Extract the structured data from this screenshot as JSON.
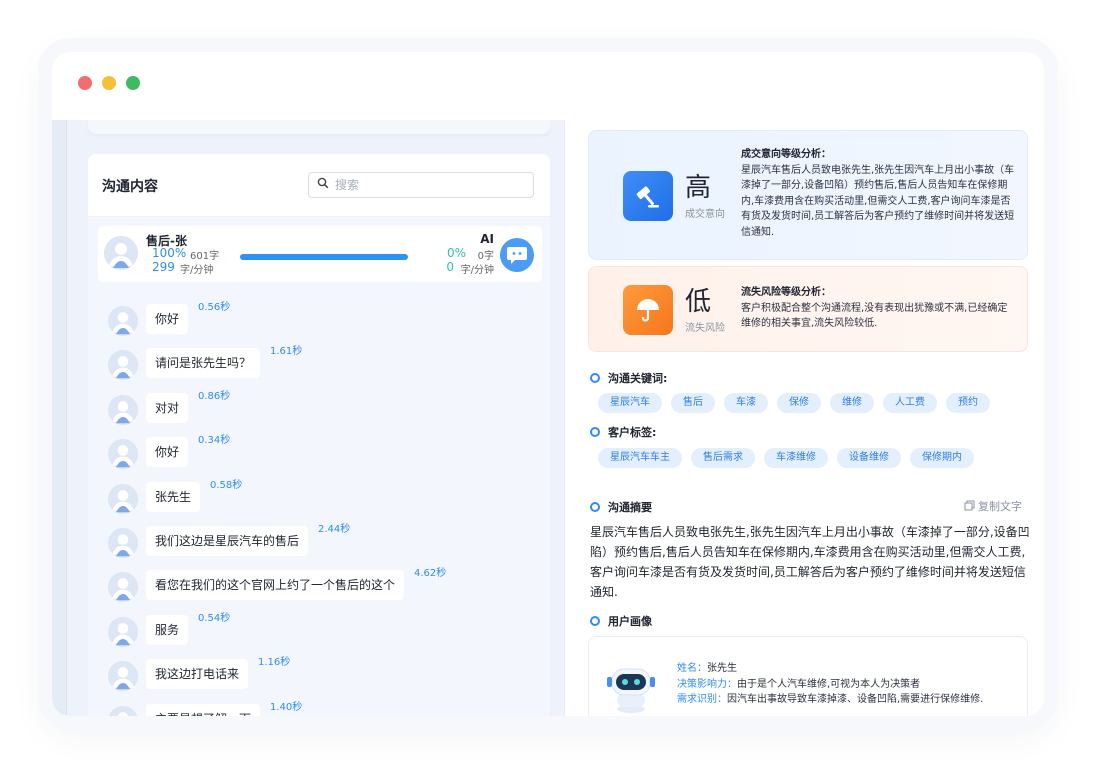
{
  "window": {
    "colors": {
      "close": "#f26d6d",
      "minimize": "#f5c038",
      "maximize": "#3dbb5f"
    }
  },
  "communication": {
    "title": "沟通内容",
    "search_placeholder": "搜索",
    "agent": {
      "name": "售后-张",
      "ratio": "100%",
      "chars": "601字",
      "speed": "299",
      "speed_unit": "字/分钟"
    },
    "ai": {
      "name": "AI",
      "ratio": "0%",
      "chars": "0字",
      "speed": "0",
      "speed_unit": "字/分钟"
    },
    "talk_ratio_progress": 1.0,
    "messages": [
      {
        "text": "你好",
        "duration": "0.56秒"
      },
      {
        "text": "请问是张先生吗？",
        "duration": "1.61秒"
      },
      {
        "text": "对对",
        "duration": "0.86秒"
      },
      {
        "text": "你好",
        "duration": "0.34秒"
      },
      {
        "text": "张先生",
        "duration": "0.58秒"
      },
      {
        "text": "我们这边是星辰汽车的售后",
        "duration": "2.44秒"
      },
      {
        "text": "看您在我们的这个官网上约了一个售后的这个",
        "duration": "4.62秒"
      },
      {
        "text": "服务",
        "duration": "0.54秒"
      },
      {
        "text": "我这边打电话来",
        "duration": "1.16秒"
      },
      {
        "text": "主要是想了解一下",
        "duration": "1.40秒"
      }
    ]
  },
  "analysis": {
    "intent": {
      "level": "高",
      "label": "成交意向",
      "title": "成交意向等级分析：",
      "text": "星辰汽车售后人员致电张先生,张先生因汽车上月出小事故（车漆掉了一部分,设备凹陷）预约售后,售后人员告知车在保修期内,车漆费用含在购买活动里,但需交人工费,客户询问车漆是否有货及发货时间,员工解答后为客户预约了维修时间并将发送短信通知."
    },
    "risk": {
      "level": "低",
      "label": "流失风险",
      "title": "流失风险等级分析：",
      "text": "客户积极配合整个沟通流程,没有表现出犹豫或不满,已经确定维修的相关事宜,流失风险较低."
    }
  },
  "keywords": {
    "title": "沟通关键词:",
    "items": [
      "星辰汽车",
      "售后",
      "车漆",
      "保修",
      "维修",
      "人工费",
      "预约"
    ]
  },
  "customer_tags": {
    "title": "客户标签:",
    "items": [
      "星辰汽车车主",
      "售后需求",
      "车漆维修",
      "设备维修",
      "保修期内"
    ]
  },
  "summary": {
    "title": "沟通摘要",
    "copy_label": "复制文字",
    "text": "星辰汽车售后人员致电张先生,张先生因汽车上月出小事故（车漆掉了一部分,设备凹陷）预约售后,售后人员告知车在保修期内,车漆费用含在购买活动里,但需交人工费,客户询问车漆是否有货及发货时间,员工解答后为客户预约了维修时间并将发送短信通知."
  },
  "portrait": {
    "title": "用户画像",
    "name_key": "姓名：",
    "name": "张先生",
    "influence_key": "决策影响力：",
    "influence": "由于是个人汽车维修,可视为本人为决策者",
    "need_key": "需求识别：",
    "need": "因汽车出事故导致车漆掉漆、设备凹陷,需要进行保修维修."
  }
}
